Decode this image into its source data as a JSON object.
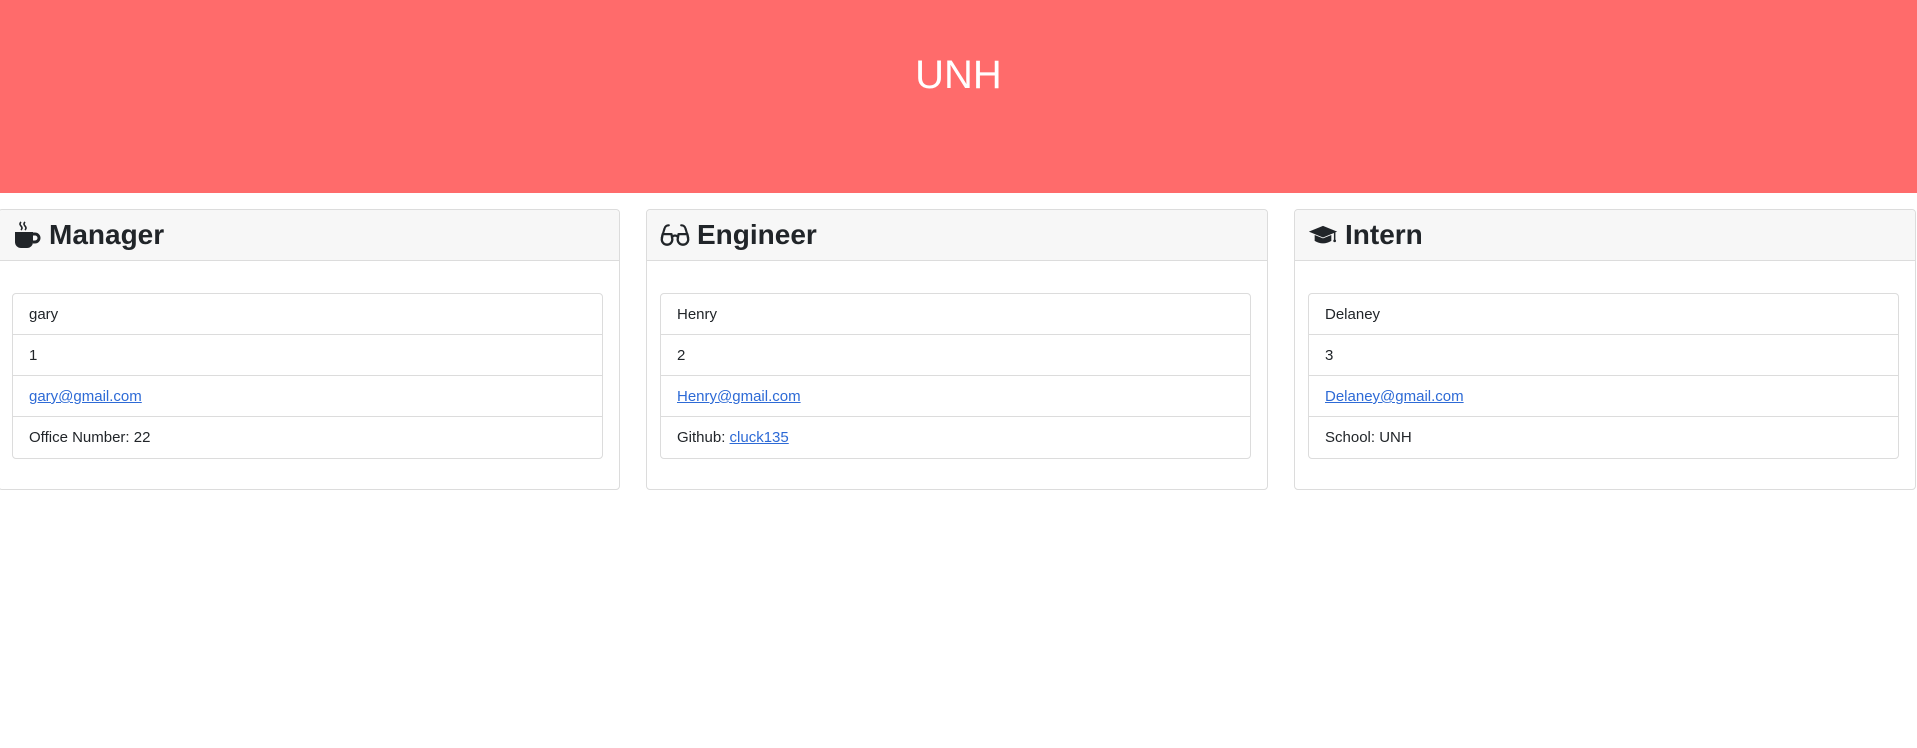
{
  "header": {
    "title": "UNH"
  },
  "cards": [
    {
      "role": "Manager",
      "icon": "coffee-icon",
      "name": "gary",
      "id": "1",
      "email": "gary@gmail.com",
      "extra_text": "Office Number: 22"
    },
    {
      "role": "Engineer",
      "icon": "glasses-icon",
      "name": "Henry",
      "id": "2",
      "email": "Henry@gmail.com",
      "extra_label": "Github: ",
      "extra_link": "cluck135"
    },
    {
      "role": "Intern",
      "icon": "graduation-cap-icon",
      "name": "Delaney",
      "id": "3",
      "email": "Delaney@gmail.com",
      "extra_text": "School: UNH"
    }
  ],
  "colors": {
    "hero_background": "#ff6b6b",
    "link": "#2d6ad6",
    "card_header": "#f7f7f7"
  }
}
